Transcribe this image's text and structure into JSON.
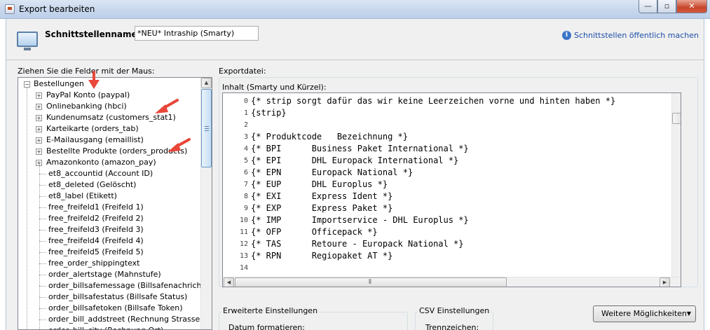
{
  "window": {
    "title": "Export bearbeiten",
    "controls": {
      "minimize": "—",
      "maximize": "▫",
      "close": "✕"
    }
  },
  "header": {
    "name_label": "Schnittstellenname:",
    "name_value": "*NEU* Intraship (Smarty)",
    "public_link": "Schnittstellen öffentlich machen"
  },
  "fields_panel": {
    "label": "Ziehen Sie die Felder mit der Maus:",
    "root": "Bestellungen",
    "groups": [
      "PayPal Konto (paypal)",
      "Onlinebanking (hbci)",
      "Kundenumsatz (customers_stat1)",
      "Karteikarte (orders_tab)",
      "E-Mailausgang (emaillist)",
      "Bestellte Produkte (orders_products)",
      "Amazonkonto (amazon_pay)"
    ],
    "fields": [
      "et8_accountid (Account ID)",
      "et8_deleted (Gelöscht)",
      "et8_label (Etikett)",
      "free_freifeld1 (Freifeld 1)",
      "free_freifeld2 (Freifeld 2)",
      "free_freifeld3 (Freifeld 3)",
      "free_freifeld4 (Freifeld 4)",
      "free_freifeld5 (Freifeld 5)",
      "free_order_shippingtext",
      "order_alertstage (Mahnstufe)",
      "order_billsafemessage (Billsafenachricht)",
      "order_billsafestatus (Billsafe Status)",
      "order_billsafetoken (Billsafe Token)",
      "order_bill_addstreet (Rechnung Strasse Zusa",
      "order_bill_city (Rechnung Ort)"
    ]
  },
  "export": {
    "label": "Exportdatei:",
    "content_label": "Inhalt (Smarty und Kürzel):",
    "lines": [
      "{* strip sorgt dafür das wir keine Leerzeichen vorne und hinten haben *}",
      "{strip}",
      "",
      "{* Produktcode   Bezeichnung *}",
      "{* BPI      Business Paket International *}",
      "{* EPI      DHL Europack International *}",
      "{* EPN      Europack National *}",
      "{* EUP      DHL Europlus *}",
      "{* EXI      Express Ident *}",
      "{* EXP      Express Paket *}",
      "{* IMP      Importservice - DHL Europlus *}",
      "{* OFP      Officepack *}",
      "{* TAS      Retoure - Europack National *}",
      "{* RPN      Regiopaket AT *}",
      ""
    ],
    "line_numbers": [
      "0",
      "1",
      "2",
      "3",
      "4",
      "5",
      "6",
      "7",
      "8",
      "9",
      "10",
      "11",
      "12",
      "13",
      "14"
    ]
  },
  "advanced": {
    "title": "Erweiterte Einstellungen",
    "date_label": "Datum formatieren:"
  },
  "csv": {
    "title": "CSV Einstellungen",
    "separator_label": "Trennzeichen:"
  },
  "more_button": "Weitere Möglichkeiten",
  "colors": {
    "arrow": "#e8473a",
    "link": "#1c4ea8"
  }
}
